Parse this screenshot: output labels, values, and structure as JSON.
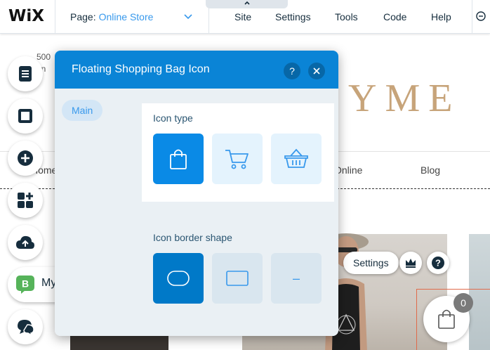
{
  "topbar": {
    "logo": "WiX",
    "page_label": "Page:",
    "page_value": "Online Store",
    "menu": [
      "Site",
      "Settings",
      "Tools",
      "Code",
      "Help"
    ]
  },
  "site": {
    "top_text_1": "500",
    "top_text_2": "an",
    "brand": "YME",
    "nav": [
      "Home",
      "Online",
      "Blog"
    ],
    "float_settings": "Settings",
    "cart_count": "0"
  },
  "rail": {
    "my_label": "My",
    "my_badge": "B"
  },
  "dialog": {
    "title": "Floating Shopping Bag Icon",
    "help": "?",
    "tab_main": "Main",
    "icon_type_label": "Icon type",
    "icon_types": [
      "bag-icon",
      "cart-icon",
      "basket-icon"
    ],
    "icon_type_selected": 0,
    "border_label": "Icon border shape",
    "border_shapes": [
      "rounded-shape-icon",
      "square-shape-icon",
      "no-border-icon"
    ],
    "border_selected": 0,
    "border_none_symbol": "–"
  },
  "colors": {
    "accent": "#0a84d6",
    "link": "#3899ec",
    "brand": "#c7a47a",
    "selection_frame": "#e06b4b"
  }
}
